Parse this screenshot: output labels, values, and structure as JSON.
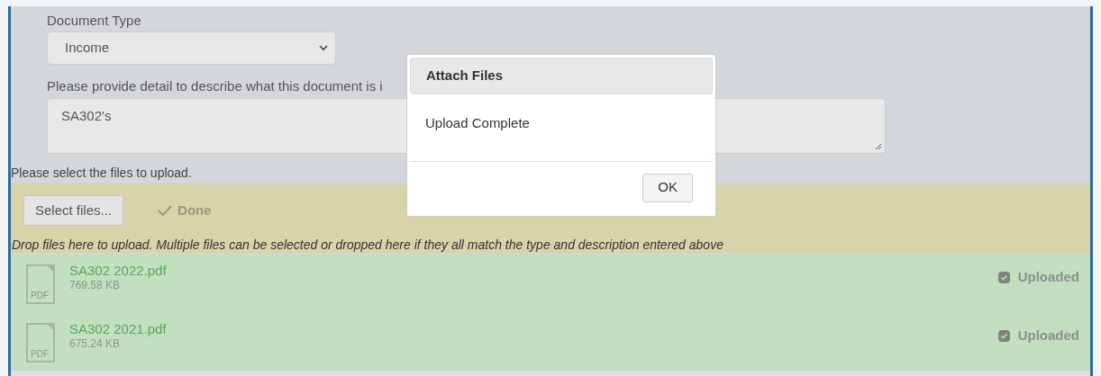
{
  "form": {
    "document_type": {
      "label": "Document Type",
      "value": "Income"
    },
    "detail": {
      "label": "Please provide detail to describe what this document is i",
      "value": "SA302's"
    },
    "select_prompt": "Please select the files to upload."
  },
  "upload": {
    "select_button": "Select files...",
    "done_button": {
      "label": "Done",
      "disabled": true
    },
    "drop_hint": "Drop files here to upload. Multiple files can be selected or dropped here if they all match the type and description entered above",
    "files": [
      {
        "name": "SA302 2022.pdf",
        "size": "769.58 KB",
        "icon_label": "PDF",
        "status": "Uploaded"
      },
      {
        "name": "SA302 2021.pdf",
        "size": "675.24 KB",
        "icon_label": "PDF",
        "status": "Uploaded"
      }
    ]
  },
  "dialog": {
    "title": "Attach Files",
    "message": "Upload Complete",
    "buttons": [
      "OK"
    ]
  }
}
